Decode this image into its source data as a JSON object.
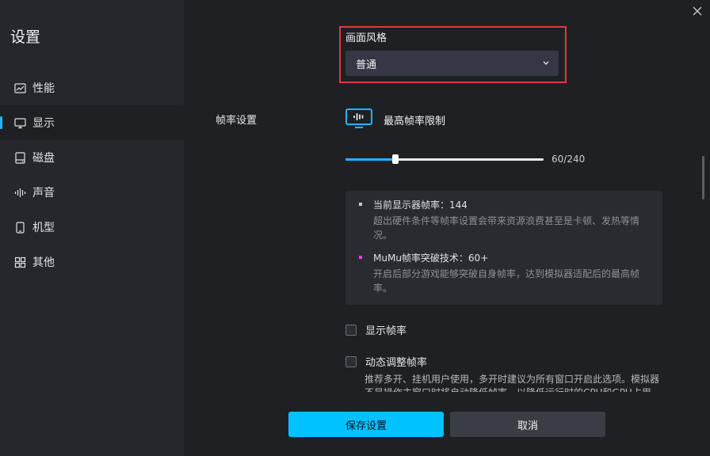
{
  "sidebar": {
    "title": "设置",
    "items": [
      {
        "label": "性能",
        "icon": "chart-icon"
      },
      {
        "label": "显示",
        "icon": "monitor-icon",
        "active": true
      },
      {
        "label": "磁盘",
        "icon": "disk-icon"
      },
      {
        "label": "声音",
        "icon": "sound-wave-icon"
      },
      {
        "label": "机型",
        "icon": "phone-icon"
      },
      {
        "label": "其他",
        "icon": "grid-icon"
      }
    ]
  },
  "display": {
    "style_label": "画面风格",
    "style_value": "普通",
    "frame_section_label": "帧率设置",
    "max_fps_title": "最高帧率限制",
    "slider": {
      "value": 60,
      "max": 240,
      "text": "60/240"
    },
    "info": {
      "line1": "当前显示器帧率：144",
      "line1_desc": "超出硬件条件等帧率设置会带来资源浪费甚至是卡顿、发热等情况。",
      "line2": "MuMu帧率突破技术：60+",
      "line2_desc": "开启后部分游戏能够突破自身帧率，达到模拟器适配后的最高帧率。"
    },
    "show_fps_label": "显示帧率",
    "dynamic_fps_label": "动态调整帧率",
    "dynamic_fps_desc": "推荐多开、挂机用户使用，多开时建议为所有窗口开启此选项。模拟器不是操作主窗口时将自动降低帧率，以降低运行时的CPU和GPU占用。"
  },
  "buttons": {
    "save": "保存设置",
    "cancel": "取消"
  },
  "colors": {
    "accent": "#00c2ff",
    "highlight_border": "#e03a3a",
    "dot1": "#c9cbd1",
    "dot2": "#ff3de6"
  }
}
